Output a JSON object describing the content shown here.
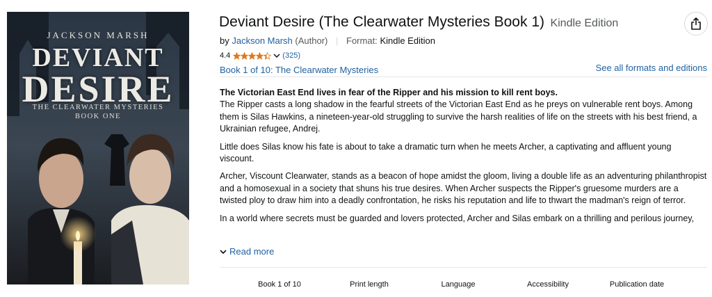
{
  "cover": {
    "author": "JACKSON MARSH",
    "title_line1": "DEVIANT",
    "title_line2": "DESIRE",
    "series_line1": "THE CLEARWATER MYSTERIES",
    "series_line2": "BOOK ONE"
  },
  "product": {
    "title": "Deviant Desire (The Clearwater Mysteries Book 1)",
    "edition": "Kindle Edition",
    "by_label": "by",
    "author": "Jackson Marsh",
    "author_role": "(Author)",
    "format_label": "Format:",
    "format_value": "Kindle Edition",
    "rating_value": "4.4",
    "rating_fraction": 0.88,
    "rating_count": "(325)",
    "series_link": "Book 1 of 10: The Clearwater Mysteries",
    "formats_link": "See all formats and editions"
  },
  "description": {
    "lead": "The Victorian East End lives in fear of the Ripper and his mission to kill rent boys.",
    "p1": "The Ripper casts a long shadow in the fearful streets of the Victorian East End as he preys on vulnerable rent boys. Among them is Silas Hawkins, a nineteen-year-old struggling to survive the harsh realities of life on the streets with his best friend, a Ukrainian refugee, Andrej.",
    "p2": "Little does Silas know his fate is about to take a dramatic turn when he meets Archer, a captivating and affluent young viscount.",
    "p3": "Archer, Viscount Clearwater, stands as a beacon of hope amidst the gloom, living a double life as an adventuring philanthropist and a homosexual in a society that shuns his true desires. When Archer suspects the Ripper's gruesome murders are a twisted ploy to draw him into a deadly confrontation, he risks his reputation and life to thwart the madman's reign of terror.",
    "p4": "In a world where secrets must be guarded and lovers protected, Archer and Silas embark on a thrilling and perilous journey,",
    "read_more": "Read more"
  },
  "attributes": [
    "Book 1 of 10",
    "Print length",
    "Language",
    "Accessibility",
    "Publication date"
  ],
  "colors": {
    "link": "#2162a1",
    "star": "#de7921",
    "muted": "#565959",
    "divider": "#e7e7e7"
  }
}
